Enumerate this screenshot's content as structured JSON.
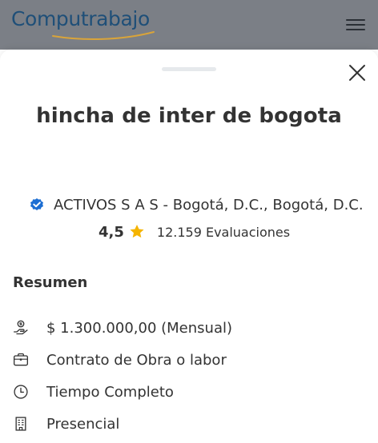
{
  "header": {
    "brand": "Computrabajo",
    "brand_color": "#1f4f78",
    "menu_icon": "hamburger-menu-icon"
  },
  "sheet": {
    "job_title": "hincha de inter de bogota",
    "company_text": "ACTIVOS S A S - Bogotá, D.C., Bogotá, D.C.",
    "verified_icon": "verified-badge-icon",
    "rating": "4,5",
    "rating_star_color": "#f5b400",
    "evaluations": "12.159 Evaluaciones"
  },
  "summary": {
    "title": "Resumen",
    "items": [
      {
        "icon": "salary-icon",
        "text": "$ 1.300.000,00 (Mensual)"
      },
      {
        "icon": "briefcase-icon",
        "text": "Contrato de Obra o labor"
      },
      {
        "icon": "clock-icon",
        "text": "Tiempo Completo"
      },
      {
        "icon": "building-icon",
        "text": "Presencial"
      }
    ]
  }
}
